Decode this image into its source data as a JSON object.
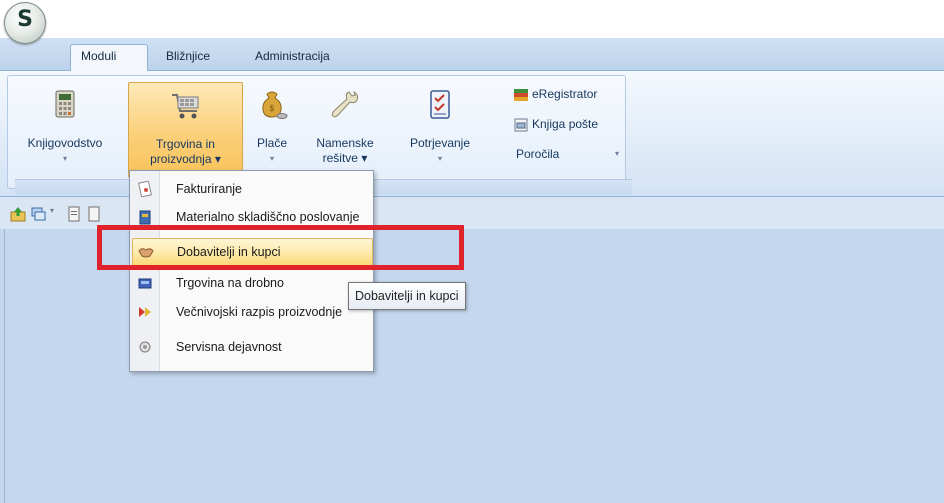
{
  "app": {
    "orb_letter": "S"
  },
  "tabs": [
    {
      "label": "Moduli",
      "active": true
    },
    {
      "label": "Bližnjice",
      "active": false
    },
    {
      "label": "Administracija",
      "active": false
    }
  ],
  "ribbon": {
    "buttons": [
      {
        "line1": "Knjigovodstvo",
        "line2": "▾",
        "icon": "calculator-icon"
      },
      {
        "line1": "Trgovina in",
        "line2": "proizvodnja ▾",
        "icon": "shopping-cart-icon",
        "selected": true
      },
      {
        "line1": "Plače",
        "line2": "▾",
        "icon": "money-bag-icon"
      },
      {
        "line1": "Namenske",
        "line2": "rešitve ▾",
        "icon": "wrench-icon"
      },
      {
        "line1": "Potrjevanje",
        "line2": "▾",
        "icon": "checklist-icon"
      }
    ],
    "small_buttons": [
      {
        "label": "eRegistrator",
        "icon": "books-icon"
      },
      {
        "label": "Knjiga pošte",
        "icon": "mail-book-icon"
      },
      {
        "label": "Poročila",
        "icon": ""
      }
    ],
    "dropdown_arrow": "▾"
  },
  "menu": {
    "items": [
      {
        "label": "Fakturiranje",
        "icon": "invoice-icon"
      },
      {
        "label": "Materialno skladiščno poslovanje",
        "icon": "warehouse-icon"
      },
      {
        "label": "Dobavitelji in kupci",
        "icon": "handshake-icon",
        "hover": true
      },
      {
        "label": "Trgovina na drobno",
        "icon": "cash-register-icon"
      },
      {
        "label": "Večnivojski razpis proizvodnje",
        "icon": "production-icon"
      },
      {
        "label": "Servisna dejavnost",
        "icon": "service-icon"
      }
    ]
  },
  "tooltip": {
    "text": "Dobavitelji in kupci"
  },
  "colors": {
    "highlight": "#e0232a",
    "accent": "#8fb2d9",
    "workspace": "#c5d7ee"
  }
}
